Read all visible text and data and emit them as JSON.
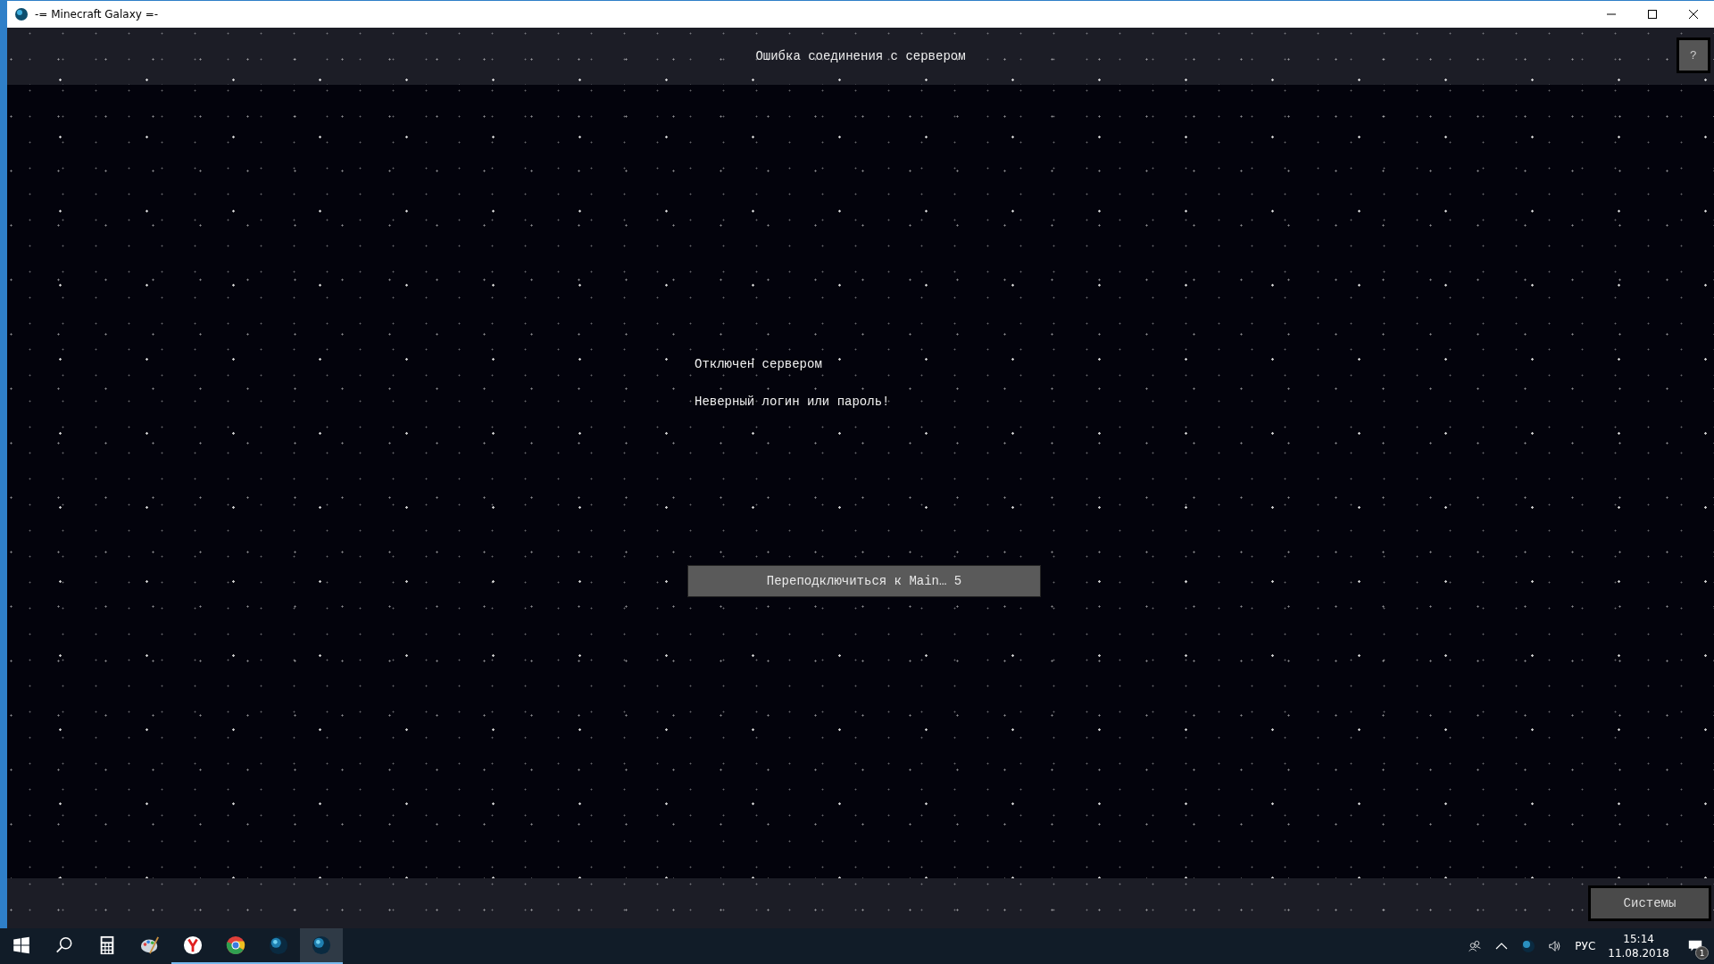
{
  "window": {
    "title": "-= Minecraft Galaxy =-"
  },
  "header": {
    "title": "Ошибка соединения с сервером",
    "help_button": "?"
  },
  "messages": [
    "Отключен сервером",
    "Неверный логин или пароль!"
  ],
  "reconnect_button": "Переподключиться к Main… 5",
  "footer": {
    "systems_button": "Системы"
  },
  "taskbar": {
    "items": [
      {
        "kind": "start",
        "running": false,
        "selected": false
      },
      {
        "kind": "search",
        "running": false,
        "selected": false
      },
      {
        "kind": "calculator",
        "running": false,
        "selected": false
      },
      {
        "kind": "paint",
        "running": false,
        "selected": false
      },
      {
        "kind": "yandex",
        "running": true,
        "selected": false
      },
      {
        "kind": "chrome",
        "running": true,
        "selected": false
      },
      {
        "kind": "globe",
        "running": true,
        "selected": false
      },
      {
        "kind": "globe",
        "running": true,
        "selected": true
      }
    ],
    "language": "РУС",
    "time": "15:14",
    "date": "11.08.2018",
    "notification_count": "1"
  }
}
